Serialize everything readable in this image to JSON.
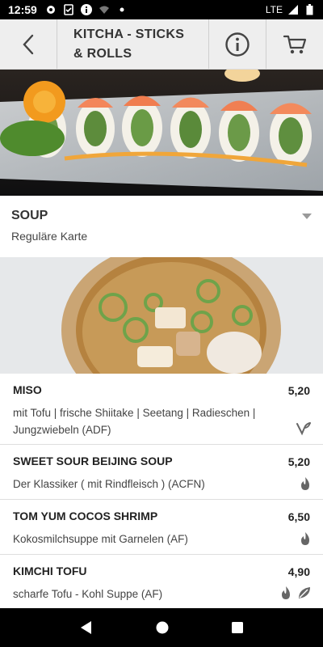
{
  "status_bar": {
    "time": "12:59",
    "network": "LTE",
    "icons": [
      "gear-icon",
      "clipboard-check-icon",
      "info-icon",
      "wifi-off-icon",
      "dot-icon",
      "signal-icon",
      "battery-icon"
    ]
  },
  "header": {
    "title": "KITCHA - STICKS & ROLLS",
    "back_icon": "back-chevron-icon",
    "info_icon": "info-circle-icon",
    "cart_icon": "cart-icon"
  },
  "category": {
    "title": "SOUP",
    "subtitle": "Reguläre Karte"
  },
  "items": [
    {
      "name": "MISO",
      "price": "5,20",
      "description": "mit Tofu | frische Shiitake | Seetang | Radieschen | Jungzwiebeln (ADF)",
      "icons": [
        "vegan-icon"
      ]
    },
    {
      "name": "SWEET SOUR BEIJING SOUP",
      "price": "5,20",
      "description": "Der Klassiker ( mit Rindfleisch ) (ACFN)",
      "icons": [
        "spicy-icon"
      ]
    },
    {
      "name": "TOM YUM COCOS SHRIMP",
      "price": "6,50",
      "description": "Kokosmilchsuppe mit Garnelen (AF)",
      "icons": [
        "spicy-icon"
      ]
    },
    {
      "name": "KIMCHI TOFU",
      "price": "4,90",
      "description": "scharfe Tofu - Kohl Suppe (AF)",
      "icons": [
        "spicy-icon",
        "vegetarian-icon"
      ]
    }
  ],
  "colors": {
    "header_bg": "#eeeeee",
    "text_dark": "#222222",
    "icon_gray": "#666666"
  }
}
